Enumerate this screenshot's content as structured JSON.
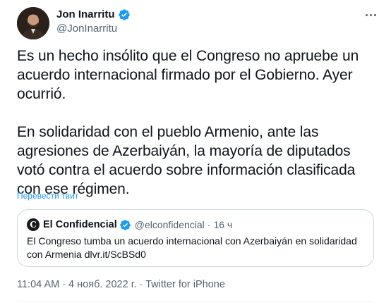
{
  "author": {
    "display_name": "Jon Inarritu",
    "handle": "@JonInarritu",
    "verified": true
  },
  "tweet": {
    "text": "Es un hecho insólito que el Congreso no apruebe un acuerdo internacional firmado por el Gobierno. Ayer ocurrió.\n\nEn solidaridad con el pueblo Armenio, ante las agresiones de Azerbaiyán, la mayoría de diputados votó contra el acuerdo sobre información clasificada con ese régimen.",
    "translate_link": "Перевести твит"
  },
  "quoted": {
    "avatar_letter": "C",
    "display_name": "El Confidencial",
    "handle": "@elconfidencial",
    "separator": "·",
    "time": "16 ч",
    "text": "El Congreso tumba un acuerdo internacional con Azerbaiyán en solidaridad con Armenia dlvr.it/ScBSd0"
  },
  "meta": {
    "time": "11:04 AM",
    "separator": "·",
    "date": "4 нояб. 2022 г.",
    "source": "Twitter for iPhone"
  },
  "icons": {
    "verified": "verified-badge-icon",
    "more": "more-horizontal-icon"
  },
  "colors": {
    "verified_blue": "#1d9bf0",
    "secondary_text": "#536471",
    "link": "#1d9bf0"
  }
}
